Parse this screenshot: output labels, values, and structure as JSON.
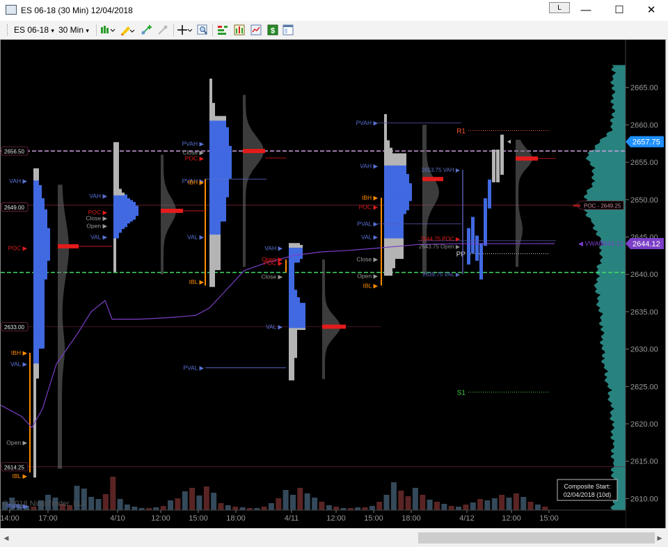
{
  "window": {
    "title": "ES 06-18 (30 Min)  12/04/2018",
    "link_button": "L",
    "minimize": "—",
    "maximize": "☐",
    "close": "✕"
  },
  "toolbar": {
    "instrument": "ES 06-18",
    "instrument_arrow": "▾",
    "interval": "30 Min",
    "interval_arrow": "▾",
    "icons": [
      "chart-style-icon",
      "drawing-tool-icon",
      "global-draw-icon",
      "hide-draw-icon",
      "crosshair-icon",
      "zoom-icon",
      "strategies-icon",
      "indicators-icon",
      "templates-icon",
      "trade-icon",
      "properties-icon"
    ]
  },
  "colors": {
    "background": "#000000",
    "up_profile": "#4169e1",
    "gray_profile": "#b4b4b4",
    "poc_bar": "#e41b1b",
    "ib_line": "#ff8c00",
    "vwap": "#7b3fc8",
    "prev_high": "#cfa0e0",
    "prev_low": "#44dd66",
    "last_price": "#1e90ff",
    "composite": "#2a8a86",
    "volume_up": "#34495a",
    "volume_down": "#5a2424"
  },
  "chart_data": {
    "type": "market-profile",
    "price_axis": {
      "min": 2606.5,
      "max": 2668,
      "ticks": [
        2610.0,
        2615.0,
        2620.0,
        2625.0,
        2630.0,
        2635.0,
        2640.0,
        2645.0,
        2650.0,
        2655.0,
        2660.0,
        2665.0
      ]
    },
    "time_axis": [
      "14:00",
      "17:00",
      "4/10",
      "12:00",
      "15:00",
      "18:00",
      "4/11",
      "12:00",
      "15:00",
      "18:00",
      "4/12",
      "12:00",
      "15:00"
    ],
    "last_price": "2657.75",
    "vwap": {
      "label": "VWAP",
      "value": "2644.12"
    },
    "composite_poc": {
      "label": "POC - 2649.25",
      "value": 2649.25
    },
    "price_tags": [
      {
        "text": "2656.50",
        "price": 2656.5
      },
      {
        "text": "2649.00",
        "price": 2649.0
      },
      {
        "text": "2633.00",
        "price": 2633.0
      },
      {
        "text": "2614.25",
        "price": 2614.25
      }
    ],
    "pivots": [
      {
        "label": "R1",
        "price": 2659.25
      },
      {
        "label": "PP",
        "price": 2642.75
      },
      {
        "label": "S1",
        "price": 2624.25
      },
      {
        "label": "S2",
        "price": 2607.5
      }
    ],
    "sessions": [
      {
        "name": "4/9",
        "high": 2654.0,
        "low": 2613.0,
        "poc": 2643.75,
        "vah": 2652.5,
        "val": 2628.25,
        "ibh": 2629.5,
        "ibl": 2613.5,
        "open": 2617.5,
        "close": null
      },
      {
        "name": "4/10",
        "high": 2657.5,
        "low": 2640.5,
        "poc": 2648.5,
        "vah": 2650.5,
        "val": 2645.0,
        "ibh": 2652.75,
        "ibl": 2638.5,
        "open": 2648.25,
        "close": 2647.5
      },
      {
        "name": "4/11",
        "high": 2644.0,
        "low": 2626.0,
        "poc": 2633.0,
        "vah": 2643.5,
        "val": 2633.0,
        "ibh": 2642.0,
        "ibl": 2640.25,
        "open": 2642.25,
        "close": 2640.25
      },
      {
        "name": "4/12",
        "high": 2661.25,
        "low": 2640.0,
        "poc": 2644.75,
        "vah": 2654.5,
        "val": 2645.0,
        "ibh": 2650.25,
        "ibl": 2638.5,
        "open": 2643.75,
        "close": 2642.5
      }
    ],
    "session_texts": [
      {
        "text": "VAH ▶",
        "color": "#5a72d6"
      },
      {
        "text": "POC ▶",
        "color": "#e41b1b"
      },
      {
        "text": "IBH ▶",
        "color": "#ff8c00"
      },
      {
        "text": "VAL ▶",
        "color": "#5a72d6"
      },
      {
        "text": "Open ▶",
        "color": "#9a9a9a"
      },
      {
        "text": "IBL ▶",
        "color": "#ff8c00"
      },
      {
        "text": "PVAL ▶",
        "color": "#5a72d6"
      },
      {
        "text": "VAH ▶",
        "color": "#5a72d6"
      },
      {
        "text": "Close ▶",
        "color": "#9a9a9a"
      },
      {
        "text": "POC ▶",
        "color": "#e41b1b"
      },
      {
        "text": "Open ▶",
        "color": "#9a9a9a"
      },
      {
        "text": "VAL ▶",
        "color": "#5a72d6"
      },
      {
        "text": "PVAH ▶",
        "color": "#5a72d6"
      },
      {
        "text": "Close ▶",
        "color": "#9a9a9a"
      },
      {
        "text": "POC ▶",
        "color": "#e41b1b"
      },
      {
        "text": "PVAH ▶",
        "color": "#5a72d6"
      },
      {
        "text": "IBH ▶",
        "color": "#ff8c00"
      },
      {
        "text": "VAL ▶",
        "color": "#5a72d6"
      },
      {
        "text": "IBL ▶",
        "color": "#ff8c00"
      },
      {
        "text": "PVAL ▶",
        "color": "#5a72d6"
      },
      {
        "text": "VAH ▶",
        "color": "#5a72d6"
      },
      {
        "text": "Open ▶",
        "color": "#e41b1b"
      },
      {
        "text": "POC ▶",
        "color": "#e41b1b"
      },
      {
        "text": "Close ▶",
        "color": "#9a9a9a"
      },
      {
        "text": "VAL ▶",
        "color": "#5a72d6"
      },
      {
        "text": "PVAH ▶",
        "color": "#5a72d6"
      },
      {
        "text": "VAH ▶",
        "color": "#5a72d6"
      },
      {
        "text": "IBH ▶",
        "color": "#ff8c00"
      },
      {
        "text": "POC ▶",
        "color": "#e41b1b"
      },
      {
        "text": "PVAL ▶",
        "color": "#5a72d6"
      },
      {
        "text": "VAL ▶",
        "color": "#5a72d6"
      },
      {
        "text": "Close ▶",
        "color": "#9a9a9a"
      },
      {
        "text": "Open ▶",
        "color": "#9a9a9a"
      },
      {
        "text": "IBL ▶",
        "color": "#ff8c00"
      },
      {
        "text": "2653.75 VAH ▶",
        "color": "#5a6ec0"
      },
      {
        "text": "2644.75 POC ▶",
        "color": "#e41b1b"
      },
      {
        "text": "2643.75 Open ▶",
        "color": "#8a8a8a"
      },
      {
        "text": "2639.75 VAL ▶",
        "color": "#5a6ec0"
      },
      {
        "text": "PVAL ▶",
        "color": "#5a72d6"
      }
    ],
    "volume": [
      {
        "v": 12,
        "up": true
      },
      {
        "v": 18,
        "up": true
      },
      {
        "v": 8,
        "up": true
      },
      {
        "v": 6,
        "up": true
      },
      {
        "v": 5,
        "up": false
      },
      {
        "v": 14,
        "up": true
      },
      {
        "v": 22,
        "up": true
      },
      {
        "v": 18,
        "up": true
      },
      {
        "v": 9,
        "up": false
      },
      {
        "v": 7,
        "up": false
      },
      {
        "v": 35,
        "up": true
      },
      {
        "v": 31,
        "up": true
      },
      {
        "v": 19,
        "up": true
      },
      {
        "v": 16,
        "up": true
      },
      {
        "v": 23,
        "up": false
      },
      {
        "v": 48,
        "up": false
      },
      {
        "v": 16,
        "up": true
      },
      {
        "v": 8,
        "up": true
      },
      {
        "v": 5,
        "up": true
      },
      {
        "v": 3,
        "up": true
      },
      {
        "v": 3,
        "up": false
      },
      {
        "v": 4,
        "up": true
      },
      {
        "v": 6,
        "up": false
      },
      {
        "v": 14,
        "up": true
      },
      {
        "v": 17,
        "up": false
      },
      {
        "v": 27,
        "up": true
      },
      {
        "v": 32,
        "up": false
      },
      {
        "v": 21,
        "up": true
      },
      {
        "v": 34,
        "up": false
      },
      {
        "v": 25,
        "up": true
      },
      {
        "v": 10,
        "up": false
      },
      {
        "v": 7,
        "up": true
      },
      {
        "v": 5,
        "up": false
      },
      {
        "v": 4,
        "up": true
      },
      {
        "v": 3,
        "up": false
      },
      {
        "v": 3,
        "up": true
      },
      {
        "v": 5,
        "up": false
      },
      {
        "v": 10,
        "up": true
      },
      {
        "v": 17,
        "up": false
      },
      {
        "v": 29,
        "up": true
      },
      {
        "v": 22,
        "up": true
      },
      {
        "v": 32,
        "up": false
      },
      {
        "v": 24,
        "up": true
      },
      {
        "v": 18,
        "up": true
      },
      {
        "v": 12,
        "up": false
      },
      {
        "v": 7,
        "up": true
      },
      {
        "v": 5,
        "up": false
      },
      {
        "v": 3,
        "up": true
      },
      {
        "v": 3,
        "up": false
      },
      {
        "v": 4,
        "up": true
      },
      {
        "v": 4,
        "up": false
      },
      {
        "v": 6,
        "up": true
      },
      {
        "v": 12,
        "up": false
      },
      {
        "v": 22,
        "up": true
      },
      {
        "v": 40,
        "up": true
      },
      {
        "v": 28,
        "up": false
      },
      {
        "v": 20,
        "up": false
      },
      {
        "v": 32,
        "up": true
      },
      {
        "v": 22,
        "up": false
      },
      {
        "v": 15,
        "up": true
      },
      {
        "v": 12,
        "up": false
      },
      {
        "v": 9,
        "up": true
      },
      {
        "v": 6,
        "up": false
      },
      {
        "v": 5,
        "up": true
      },
      {
        "v": 8,
        "up": false
      },
      {
        "v": 11,
        "up": true
      },
      {
        "v": 16,
        "up": false
      },
      {
        "v": 14,
        "up": true
      },
      {
        "v": 17,
        "up": true
      },
      {
        "v": 22,
        "up": false
      },
      {
        "v": 18,
        "up": true
      },
      {
        "v": 24,
        "up": false
      },
      {
        "v": 19,
        "up": true
      },
      {
        "v": 12,
        "up": false
      },
      {
        "v": 8,
        "up": true
      },
      {
        "v": 5,
        "up": false
      }
    ],
    "copyright": "© 2018 NinjaTrader, LLC",
    "composite_title": "Composite Start:",
    "composite_start": "02/04/2018 (10d)"
  }
}
